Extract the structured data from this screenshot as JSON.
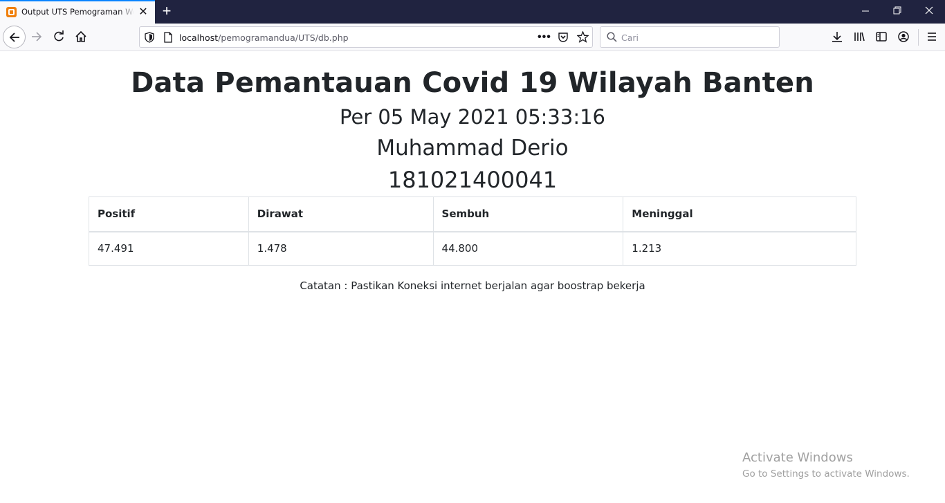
{
  "browser": {
    "tab_title": "Output UTS Pemograman Web",
    "url_host": "localhost",
    "url_path": "/pemogramandua/UTS/db.php",
    "search_placeholder": "Cari"
  },
  "page": {
    "title": "Data Pemantauan Covid 19 Wilayah Banten",
    "date_line": "Per 05 May 2021 05:33:16",
    "name": "Muhammad Derio",
    "nim": "181021400041",
    "table": {
      "headers": [
        "Positif",
        "Dirawat",
        "Sembuh",
        "Meninggal"
      ],
      "rows": [
        [
          "47.491",
          "1.478",
          "44.800",
          "1.213"
        ]
      ]
    },
    "note": "Catatan : Pastikan Koneksi internet berjalan agar boostrap bekerja"
  },
  "watermark": {
    "title": "Activate Windows",
    "subtitle": "Go to Settings to activate Windows."
  }
}
